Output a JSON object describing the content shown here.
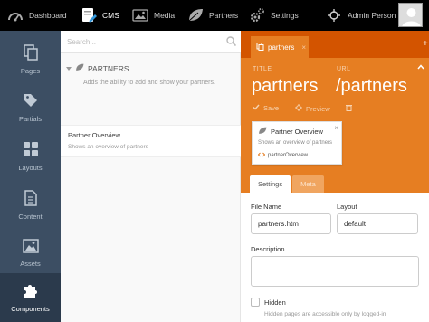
{
  "topbar": {
    "nav": [
      {
        "label": "Dashboard",
        "icon": "dashboard-icon"
      },
      {
        "label": "CMS",
        "icon": "cms-icon"
      },
      {
        "label": "Media",
        "icon": "media-icon"
      },
      {
        "label": "Partners",
        "icon": "leaf-icon"
      },
      {
        "label": "Settings",
        "icon": "gear-icon"
      }
    ],
    "active": "CMS",
    "user": {
      "name": "Admin Person",
      "icon": "crosshair-icon"
    }
  },
  "sidebar": {
    "items": [
      {
        "label": "Pages",
        "icon": "pages-icon"
      },
      {
        "label": "Partials",
        "icon": "tag-icon"
      },
      {
        "label": "Layouts",
        "icon": "grid-icon"
      },
      {
        "label": "Content",
        "icon": "document-icon"
      },
      {
        "label": "Assets",
        "icon": "image-icon"
      },
      {
        "label": "Components",
        "icon": "puzzle-icon"
      }
    ],
    "active": "Components"
  },
  "list": {
    "search_placeholder": "Search...",
    "group": {
      "title": "PARTNERS",
      "description": "Adds the ability to add and show your partners."
    },
    "items": [
      {
        "title": "Partner Overview",
        "description": "Shows an overview of partners"
      }
    ]
  },
  "editor": {
    "tab": {
      "label": "partners",
      "close": "×"
    },
    "add_tab": "+",
    "fields": {
      "title_label": "TITLE",
      "title_value": "partners",
      "url_label": "URL",
      "url_value": "/partners"
    },
    "toolbar": {
      "save": "Save",
      "preview": "Preview"
    },
    "component_card": {
      "title": "Partner Overview",
      "description": "Shows an overview of partners",
      "code": "partnerOverview",
      "close": "×"
    },
    "inner_tabs": [
      "Settings",
      "Meta"
    ],
    "settings": {
      "file_name_label": "File Name",
      "file_name_value": "partners.htm",
      "layout_label": "Layout",
      "layout_value": "default",
      "description_label": "Description",
      "description_value": "",
      "hidden_label": "Hidden",
      "hidden_desc": "Hidden pages are accessible only by logged-in"
    }
  },
  "colors": {
    "topbar": "#000000",
    "sidebar": "#3c4e63",
    "sidebar_active": "#2b3a4c",
    "accent": "#e67e22",
    "accent_dark": "#d35400"
  }
}
